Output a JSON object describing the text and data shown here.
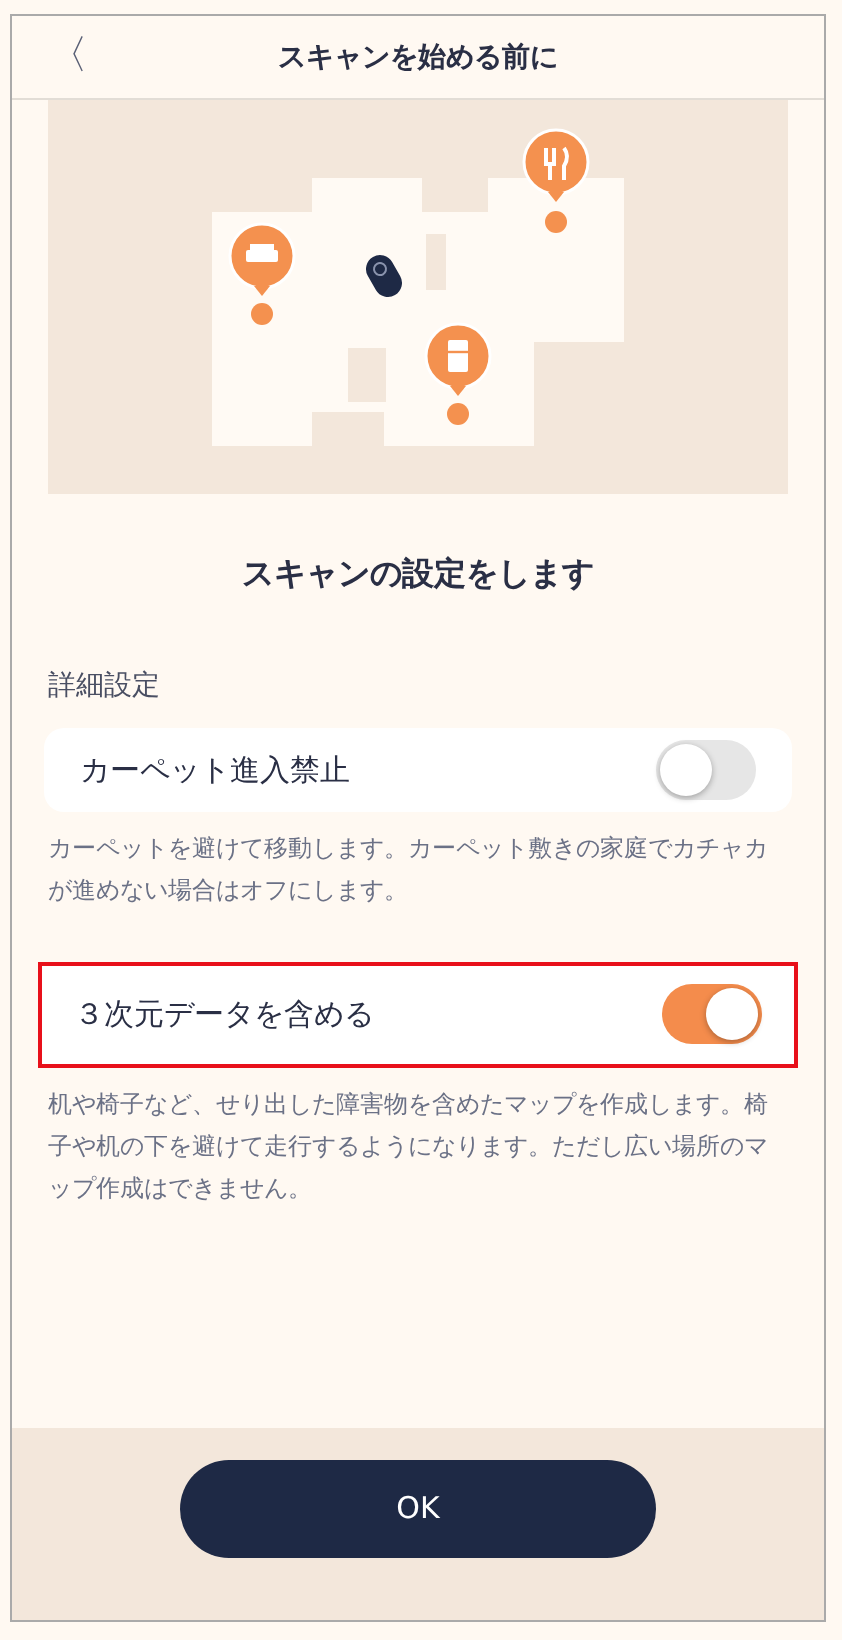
{
  "header": {
    "back": "〈",
    "title": "スキャンを始める前に"
  },
  "heading": "スキャンの設定をします",
  "section_label": "詳細設定",
  "settings": [
    {
      "label": "カーペット進入禁止",
      "on": false,
      "highlighted": false,
      "description": "カーペットを避けて移動します。カーペット敷きの家庭でカチャカが進めない場合はオフにします。"
    },
    {
      "label": "３次元データを含める",
      "on": true,
      "highlighted": true,
      "description": "机や椅子など、せり出した障害物を含めたマップを作成します。椅子や机の下を避けて走行するようになります。ただし広い場所のマップ作成はできません。"
    }
  ],
  "button": "OK"
}
